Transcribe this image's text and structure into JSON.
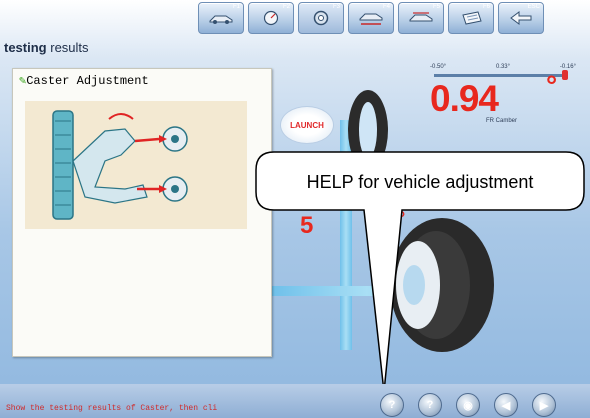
{
  "toolbar": {
    "buttons": [
      {
        "key": "F1",
        "icon": "vehicle-icon"
      },
      {
        "key": "F2",
        "icon": "gauge-icon"
      },
      {
        "key": "F3",
        "icon": "wheel-icon"
      },
      {
        "key": "F4",
        "icon": "vehicle-lift-icon"
      },
      {
        "key": "F5",
        "icon": "vehicle-measure-icon"
      },
      {
        "key": "F6",
        "icon": "print-icon"
      },
      {
        "key": "ESC",
        "icon": "back-arrow-icon"
      }
    ]
  },
  "header": {
    "title_bold": "testing",
    "title_rest": " results"
  },
  "help_panel": {
    "title": "Caster Adjustment"
  },
  "gauge": {
    "ticks": [
      "-0.50°",
      "0.33°",
      "-0.16°"
    ],
    "value": "0.94",
    "unit": "°",
    "label": "FR Camber"
  },
  "launch": {
    "label": "LAUNCH"
  },
  "partial_values": {
    "left": "5",
    "right": "°"
  },
  "callout": {
    "text": "HELP for vehicle adjustment"
  },
  "status": {
    "text": "Show the testing results of Caster, then cli"
  },
  "bottom_buttons": [
    {
      "name": "help-button",
      "glyph": "?"
    },
    {
      "name": "question-button",
      "glyph": "?"
    },
    {
      "name": "view-button",
      "glyph": "◉"
    },
    {
      "name": "previous-button",
      "glyph": "◀"
    },
    {
      "name": "next-button",
      "glyph": "▶"
    }
  ],
  "colors": {
    "accent_red": "#e8281e",
    "background_blue": "#a8c7e6"
  }
}
